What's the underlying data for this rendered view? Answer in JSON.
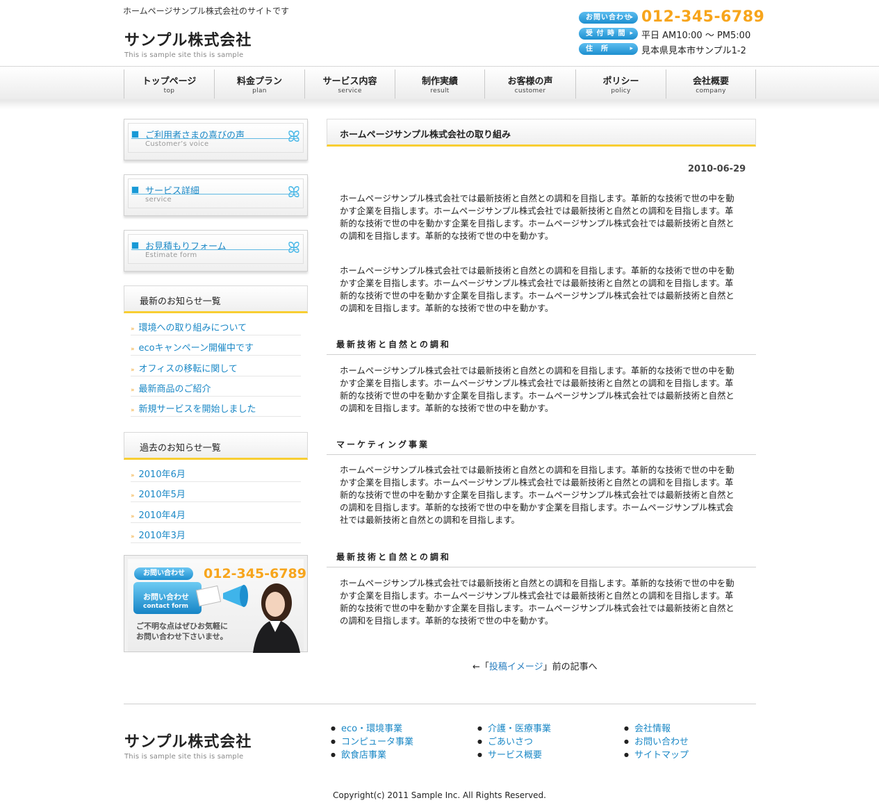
{
  "header": {
    "tagline": "ホームページサンプル株式会社のサイトです",
    "logo_title": "サンプル株式会社",
    "logo_sub": "This is sample site this is sample",
    "contact_label": "お問い合わせ",
    "phone": "012-345-6789",
    "hours_label": "受 付 時 間",
    "hours": "平日 AM10:00 ～ PM5:00",
    "address_label": "住　所",
    "address": "見本県見本市サンプル1-2"
  },
  "nav": [
    {
      "ja": "トップページ",
      "en": "top"
    },
    {
      "ja": "料金プラン",
      "en": "plan"
    },
    {
      "ja": "サービス内容",
      "en": "service"
    },
    {
      "ja": "制作実績",
      "en": "result"
    },
    {
      "ja": "お客様の声",
      "en": "customer"
    },
    {
      "ja": "ポリシー",
      "en": "policy"
    },
    {
      "ja": "会社概要",
      "en": "company"
    }
  ],
  "sidebar": {
    "banners": [
      {
        "title": "ご利用者さまの喜びの声",
        "sub": "Customer’s voice"
      },
      {
        "title": "サービス詳細",
        "sub": "service"
      },
      {
        "title": "お見積もりフォーム",
        "sub": "Estimate form"
      }
    ],
    "latest_title": "最新のお知らせ一覧",
    "latest": [
      "環境への取り組みについて",
      "ecoキャンペーン開催中です",
      "オフィスの移転に関して",
      "最新商品のご紹介",
      "新規サービスを開始しました"
    ],
    "past_title": "過去のお知らせ一覧",
    "past": [
      "2010年6月",
      "2010年5月",
      "2010年4月",
      "2010年3月"
    ],
    "contact_box": {
      "pill": "お問い合わせ",
      "phone": "012-345-6789",
      "button_ja": "お問い合わせ",
      "button_en": "contact form",
      "note_line1": "ご不明な点はぜひお気軽に",
      "note_line2": "お問い合わせ下さいませ。"
    }
  },
  "main": {
    "title": "ホームページサンプル株式会社の取り組み",
    "date": "2010-06-29",
    "paragraphs": [
      "ホームページサンプル株式会社では最新技術と自然との調和を目指します。革新的な技術で世の中を動かす企業を目指します。ホームページサンプル株式会社では最新技術と自然との調和を目指します。革新的な技術で世の中を動かす企業を目指します。ホームページサンプル株式会社では最新技術と自然との調和を目指します。革新的な技術で世の中を動かす。",
      "ホームページサンプル株式会社では最新技術と自然との調和を目指します。革新的な技術で世の中を動かす企業を目指します。ホームページサンプル株式会社では最新技術と自然との調和を目指します。革新的な技術で世の中を動かす企業を目指します。ホームページサンプル株式会社では最新技術と自然との調和を目指します。革新的な技術で世の中を動かす。",
      "ホームページサンプル株式会社では最新技術と自然との調和を目指します。革新的な技術で世の中を動かす企業を目指します。ホームページサンプル株式会社では最新技術と自然との調和を目指します。革新的な技術で世の中を動かす企業を目指します。ホームページサンプル株式会社では最新技術と自然との調和を目指します。革新的な技術で世の中を動かす。",
      "ホームページサンプル株式会社では最新技術と自然との調和を目指します。革新的な技術で世の中を動かす企業を目指します。ホームページサンプル株式会社では最新技術と自然との調和を目指します。革新的な技術で世の中を動かす企業を目指します。ホームページサンプル株式会社では最新技術と自然との調和を目指します。革新的な技術で世の中を動かす企業を目指します。ホームページサンプル株式会社では最新技術と自然との調和を目指します。",
      "ホームページサンプル株式会社では最新技術と自然との調和を目指します。革新的な技術で世の中を動かす企業を目指します。ホームページサンプル株式会社では最新技術と自然との調和を目指します。革新的な技術で世の中を動かす企業を目指します。ホームページサンプル株式会社では最新技術と自然との調和を目指します。革新的な技術で世の中を動かす。"
    ],
    "subheads": [
      "最新技術と自然との調和",
      "マーケティング事業",
      "最新技術と自然との調和"
    ],
    "prev_arrow": "←「",
    "prev_link": "投稿イメージ",
    "prev_suffix": "」前の記事へ"
  },
  "footer": {
    "logo_title": "サンプル株式会社",
    "logo_sub": "This is sample site this is sample",
    "col1": [
      "eco・環境事業",
      "コンピュータ事業",
      "飲食店事業"
    ],
    "col2": [
      "介護・医療事業",
      "ごあいさつ",
      "サービス概要"
    ],
    "col3": [
      "会社情報",
      "お問い合わせ",
      "サイトマップ"
    ],
    "copyright": "Copyright(c) 2011 Sample Inc. All Rights Reserved."
  },
  "colors": {
    "accent_blue": "#1b88c6",
    "accent_orange": "#f7a51c",
    "accent_yellow": "#f8ce32"
  }
}
